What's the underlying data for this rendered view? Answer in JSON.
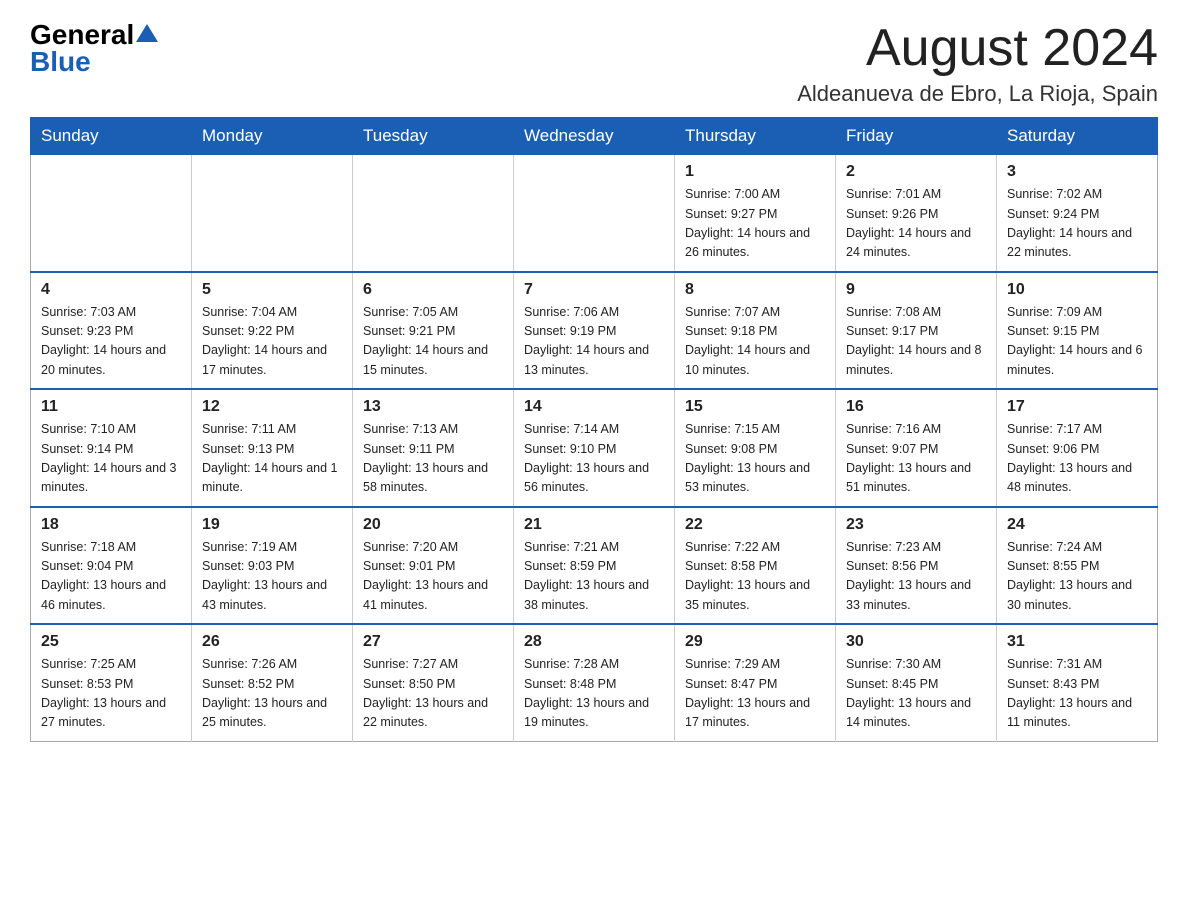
{
  "header": {
    "logo_general": "General",
    "logo_blue": "Blue",
    "month_title": "August 2024",
    "location": "Aldeanueva de Ebro, La Rioja, Spain"
  },
  "days_of_week": [
    "Sunday",
    "Monday",
    "Tuesday",
    "Wednesday",
    "Thursday",
    "Friday",
    "Saturday"
  ],
  "weeks": [
    [
      {
        "num": "",
        "info": ""
      },
      {
        "num": "",
        "info": ""
      },
      {
        "num": "",
        "info": ""
      },
      {
        "num": "",
        "info": ""
      },
      {
        "num": "1",
        "info": "Sunrise: 7:00 AM\nSunset: 9:27 PM\nDaylight: 14 hours\nand 26 minutes."
      },
      {
        "num": "2",
        "info": "Sunrise: 7:01 AM\nSunset: 9:26 PM\nDaylight: 14 hours\nand 24 minutes."
      },
      {
        "num": "3",
        "info": "Sunrise: 7:02 AM\nSunset: 9:24 PM\nDaylight: 14 hours\nand 22 minutes."
      }
    ],
    [
      {
        "num": "4",
        "info": "Sunrise: 7:03 AM\nSunset: 9:23 PM\nDaylight: 14 hours\nand 20 minutes."
      },
      {
        "num": "5",
        "info": "Sunrise: 7:04 AM\nSunset: 9:22 PM\nDaylight: 14 hours\nand 17 minutes."
      },
      {
        "num": "6",
        "info": "Sunrise: 7:05 AM\nSunset: 9:21 PM\nDaylight: 14 hours\nand 15 minutes."
      },
      {
        "num": "7",
        "info": "Sunrise: 7:06 AM\nSunset: 9:19 PM\nDaylight: 14 hours\nand 13 minutes."
      },
      {
        "num": "8",
        "info": "Sunrise: 7:07 AM\nSunset: 9:18 PM\nDaylight: 14 hours\nand 10 minutes."
      },
      {
        "num": "9",
        "info": "Sunrise: 7:08 AM\nSunset: 9:17 PM\nDaylight: 14 hours\nand 8 minutes."
      },
      {
        "num": "10",
        "info": "Sunrise: 7:09 AM\nSunset: 9:15 PM\nDaylight: 14 hours\nand 6 minutes."
      }
    ],
    [
      {
        "num": "11",
        "info": "Sunrise: 7:10 AM\nSunset: 9:14 PM\nDaylight: 14 hours\nand 3 minutes."
      },
      {
        "num": "12",
        "info": "Sunrise: 7:11 AM\nSunset: 9:13 PM\nDaylight: 14 hours\nand 1 minute."
      },
      {
        "num": "13",
        "info": "Sunrise: 7:13 AM\nSunset: 9:11 PM\nDaylight: 13 hours\nand 58 minutes."
      },
      {
        "num": "14",
        "info": "Sunrise: 7:14 AM\nSunset: 9:10 PM\nDaylight: 13 hours\nand 56 minutes."
      },
      {
        "num": "15",
        "info": "Sunrise: 7:15 AM\nSunset: 9:08 PM\nDaylight: 13 hours\nand 53 minutes."
      },
      {
        "num": "16",
        "info": "Sunrise: 7:16 AM\nSunset: 9:07 PM\nDaylight: 13 hours\nand 51 minutes."
      },
      {
        "num": "17",
        "info": "Sunrise: 7:17 AM\nSunset: 9:06 PM\nDaylight: 13 hours\nand 48 minutes."
      }
    ],
    [
      {
        "num": "18",
        "info": "Sunrise: 7:18 AM\nSunset: 9:04 PM\nDaylight: 13 hours\nand 46 minutes."
      },
      {
        "num": "19",
        "info": "Sunrise: 7:19 AM\nSunset: 9:03 PM\nDaylight: 13 hours\nand 43 minutes."
      },
      {
        "num": "20",
        "info": "Sunrise: 7:20 AM\nSunset: 9:01 PM\nDaylight: 13 hours\nand 41 minutes."
      },
      {
        "num": "21",
        "info": "Sunrise: 7:21 AM\nSunset: 8:59 PM\nDaylight: 13 hours\nand 38 minutes."
      },
      {
        "num": "22",
        "info": "Sunrise: 7:22 AM\nSunset: 8:58 PM\nDaylight: 13 hours\nand 35 minutes."
      },
      {
        "num": "23",
        "info": "Sunrise: 7:23 AM\nSunset: 8:56 PM\nDaylight: 13 hours\nand 33 minutes."
      },
      {
        "num": "24",
        "info": "Sunrise: 7:24 AM\nSunset: 8:55 PM\nDaylight: 13 hours\nand 30 minutes."
      }
    ],
    [
      {
        "num": "25",
        "info": "Sunrise: 7:25 AM\nSunset: 8:53 PM\nDaylight: 13 hours\nand 27 minutes."
      },
      {
        "num": "26",
        "info": "Sunrise: 7:26 AM\nSunset: 8:52 PM\nDaylight: 13 hours\nand 25 minutes."
      },
      {
        "num": "27",
        "info": "Sunrise: 7:27 AM\nSunset: 8:50 PM\nDaylight: 13 hours\nand 22 minutes."
      },
      {
        "num": "28",
        "info": "Sunrise: 7:28 AM\nSunset: 8:48 PM\nDaylight: 13 hours\nand 19 minutes."
      },
      {
        "num": "29",
        "info": "Sunrise: 7:29 AM\nSunset: 8:47 PM\nDaylight: 13 hours\nand 17 minutes."
      },
      {
        "num": "30",
        "info": "Sunrise: 7:30 AM\nSunset: 8:45 PM\nDaylight: 13 hours\nand 14 minutes."
      },
      {
        "num": "31",
        "info": "Sunrise: 7:31 AM\nSunset: 8:43 PM\nDaylight: 13 hours\nand 11 minutes."
      }
    ]
  ]
}
